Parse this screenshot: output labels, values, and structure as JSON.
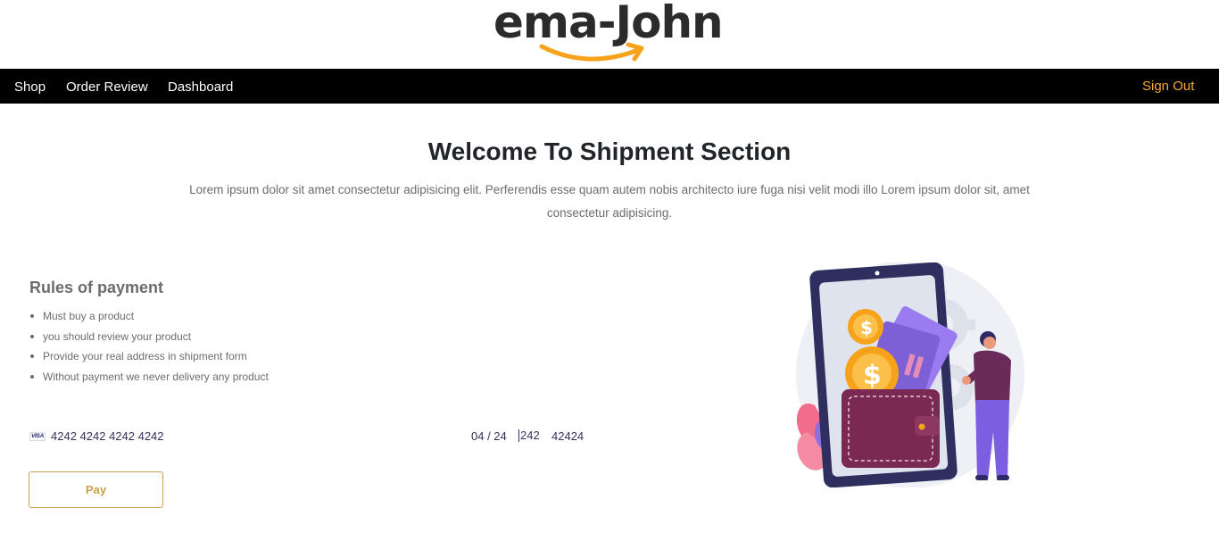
{
  "brand": {
    "logo_text": "ema-John"
  },
  "nav": {
    "items": [
      {
        "label": "Shop"
      },
      {
        "label": "Order Review"
      },
      {
        "label": "Dashboard"
      }
    ],
    "sign_out": "Sign Out"
  },
  "main": {
    "title": "Welcome To Shipment Section",
    "intro": "Lorem ipsum dolor sit amet consectetur adipisicing elit. Perferendis esse quam autem nobis architecto iure fuga nisi velit modi illo Lorem ipsum dolor sit, amet consectetur adipisicing."
  },
  "rules": {
    "title": "Rules of payment",
    "items": [
      "Must buy a product",
      "you should review your product",
      "Provide your real address in shipment form",
      "Without payment we never delivery any product"
    ]
  },
  "card": {
    "brand_text": "VISA",
    "number": "4242 4242 4242 4242",
    "expiry": "04 / 24",
    "cvc": "242",
    "zip": "42424"
  },
  "payment": {
    "pay_label": "Pay"
  },
  "colors": {
    "navbar": "#000000",
    "sign_out": "#f7a738",
    "pay_accent": "#c8a24a",
    "logo_smile": "#f7a21b"
  }
}
